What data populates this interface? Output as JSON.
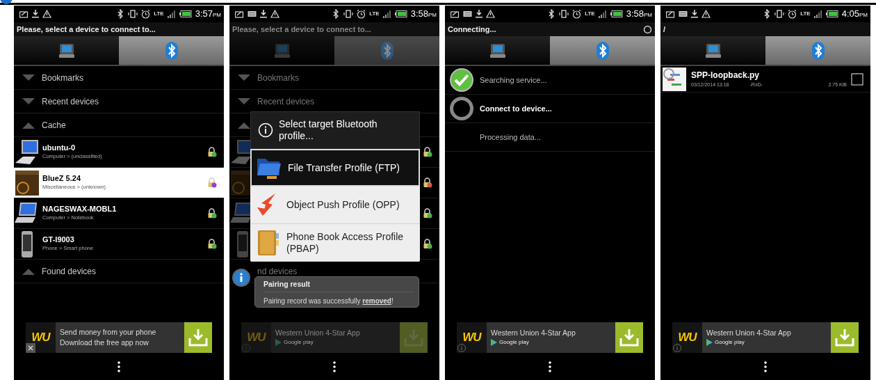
{
  "screens": [
    {
      "status_bar": {
        "notifications": [
          {
            "kind": "message"
          },
          {
            "kind": "download"
          },
          {
            "kind": "warning"
          }
        ],
        "network": "LTE",
        "time": "3:57",
        "ampm": "PM"
      },
      "title": "Please, select a device to connect to...",
      "dimmed": false,
      "tabs": [
        {
          "kind": "computer",
          "selected": false
        },
        {
          "kind": "bluetooth",
          "selected": true
        }
      ],
      "content": {
        "kind": "devices",
        "rows": [
          {
            "label": "Bookmarks",
            "expanded": false
          },
          {
            "label": "Recent devices",
            "expanded": false
          },
          {
            "label": "Cache",
            "expanded": true,
            "children": [
              {
                "name": "ubuntu-0",
                "type": "Computer > (unclassified)",
                "kind": "desktop",
                "selected": false,
                "color": "#4caf50"
              },
              {
                "name": "BlueZ 5.24",
                "type": "Miscellaneous > (unknown)",
                "kind": "box",
                "selected": true,
                "color": "#9b3fc9"
              },
              {
                "name": "NAGESWAX-MOBL1",
                "type": "Computer > Notebook",
                "kind": "laptop",
                "selected": false,
                "color": "#4caf50"
              },
              {
                "name": "GT-I9003",
                "type": "Phone > Smart phone",
                "kind": "phone",
                "selected": false,
                "color": "#4caf50"
              }
            ]
          },
          {
            "label": "Found devices",
            "expanded": true
          }
        ]
      },
      "ad": {
        "logo": "WU",
        "lines": [
          "Send money from your phone",
          "Download the free app now"
        ],
        "closable": true
      }
    },
    {
      "status_bar": {
        "notifications": [
          {
            "kind": "message"
          },
          {
            "kind": "keyboard"
          },
          {
            "kind": "download"
          },
          {
            "kind": "warning"
          }
        ],
        "network": "LTE",
        "time": "3:58",
        "ampm": "PM"
      },
      "title": "Please, select a device to connect to...",
      "dimmed": true,
      "tabs": [
        {
          "kind": "computer",
          "selected": false
        },
        {
          "kind": "bluetooth",
          "selected": true
        }
      ],
      "content": {
        "kind": "devices",
        "rows": [
          {
            "label": "Bookmarks",
            "expanded": false
          },
          {
            "label": "Recent devices",
            "expanded": false
          },
          {
            "expanded": true,
            "children": [
              {
                "kind": "desktop",
                "selected": false,
                "color": "#4caf50"
              },
              {
                "kind": "box",
                "selected": false,
                "color": "#d9534f"
              },
              {
                "kind": "laptop",
                "selected": false,
                "color": "#4caf50"
              },
              {
                "kind": "phone",
                "selected": false,
                "color": "#4caf50"
              }
            ]
          },
          {
            "label": "nd devices",
            "expanded": true
          }
        ]
      },
      "dialog": {
        "title": "Select target Bluetooth profile...",
        "items": [
          {
            "label": "File Transfer Profile (FTP)",
            "kind": "folder",
            "selected": true
          },
          {
            "label": "Object Push Profile (OPP)",
            "kind": "arrow",
            "selected": false
          },
          {
            "label": "Phone Book Access Profile (PBAP)",
            "kind": "book",
            "selected": false
          }
        ]
      },
      "toast": {
        "title": "Pairing result",
        "message": "Pairing record was successfully **removed**!"
      },
      "ad": {
        "logo": "WU",
        "lines": [
          "Western Union 4-Star App"
        ],
        "store": "Google play",
        "closable": false
      }
    },
    {
      "status_bar": {
        "notifications": [
          {
            "kind": "message"
          },
          {
            "kind": "keyboard"
          },
          {
            "kind": "download"
          },
          {
            "kind": "warning"
          }
        ],
        "network": "LTE",
        "time": "3:58",
        "ampm": "PM"
      },
      "title": "Connecting...",
      "busy": true,
      "dimmed": false,
      "tabs": [
        {
          "kind": "computer",
          "selected": false
        },
        {
          "kind": "bluetooth",
          "selected": true
        }
      ],
      "content": {
        "kind": "steps",
        "rows": [
          {
            "label": "Searching service...",
            "kind": "done"
          },
          {
            "label": "Connect to device...",
            "kind": "active"
          },
          {
            "label": "Processing data...",
            "kind": "pending"
          }
        ]
      },
      "ad": {
        "logo": "WU",
        "lines": [
          "Western Union 4-Star App"
        ],
        "store": "Google play",
        "closable": false
      }
    },
    {
      "status_bar": {
        "notifications": [
          {
            "kind": "message"
          },
          {
            "kind": "keyboard"
          },
          {
            "kind": "download"
          },
          {
            "kind": "warning"
          }
        ],
        "network": "LTE",
        "time": "4:05",
        "ampm": "PM"
      },
      "title": "/",
      "dimmed": false,
      "tabs": [
        {
          "kind": "computer",
          "selected": false
        },
        {
          "kind": "bluetooth",
          "selected": true
        }
      ],
      "content": {
        "kind": "files",
        "rows": [
          {
            "name": "SPP-loopback.py",
            "date": "03/12/2014 13:18",
            "attributes": "-RxD-",
            "size": "2.75 KiB",
            "checked": false
          }
        ]
      },
      "ad": {
        "logo": "WU",
        "lines": [
          "Western Union 4-Star App"
        ],
        "store": "Google play",
        "closable": false
      }
    }
  ]
}
